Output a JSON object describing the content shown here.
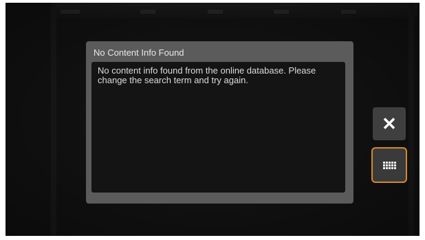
{
  "dialog": {
    "title": "No Content Info Found",
    "message": "No content info found from the online database. Please change the search term and try again."
  },
  "buttons": {
    "close_icon": "close-icon",
    "keyboard_icon": "keyboard-icon"
  },
  "colors": {
    "dialog_frame": "#5b5b5b",
    "dialog_body": "#141414",
    "focus_border": "#d48a2a",
    "background": "#111111"
  }
}
